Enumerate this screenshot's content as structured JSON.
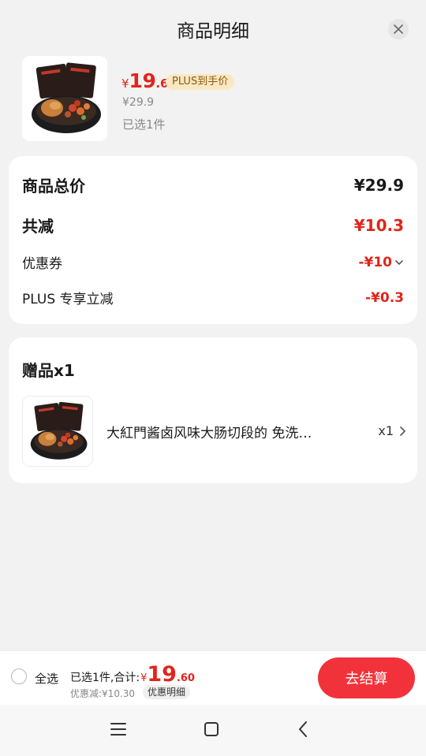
{
  "header": {
    "title": "商品明细"
  },
  "product": {
    "price_symbol": "¥",
    "price_int": "19",
    "price_dec": ".6",
    "plus_badge": "PLUS到手价",
    "original_price": "¥29.9",
    "selected": "已选1件"
  },
  "price_detail": {
    "total_label": "商品总价",
    "total_value": "¥29.9",
    "reduce_label": "共减",
    "reduce_value": "¥10.3",
    "coupon_label": "优惠券",
    "coupon_value": "-¥10",
    "plus_label": "PLUS 专享立减",
    "plus_value": "-¥0.3"
  },
  "gift": {
    "title": "赠品x1",
    "name": "大紅門酱卤风味大肠切段的 免洗…",
    "qty": "x1"
  },
  "bottom_bar": {
    "select_all": "全选",
    "sum_label": "已选1件,合计:",
    "sum_symbol": "¥",
    "sum_int": "19",
    "sum_dec": ".60",
    "discount": "优惠减:¥10.30",
    "detail_badge": "优惠明细",
    "checkout": "去结算"
  },
  "colors": {
    "accent_red": "#e1251b",
    "button_red": "#f2323a",
    "plus_gold": "#fbe8c3"
  },
  "icons": [
    "close-icon",
    "chevron-down-icon",
    "chevron-right-icon",
    "menu-icon",
    "home-icon",
    "back-icon"
  ]
}
